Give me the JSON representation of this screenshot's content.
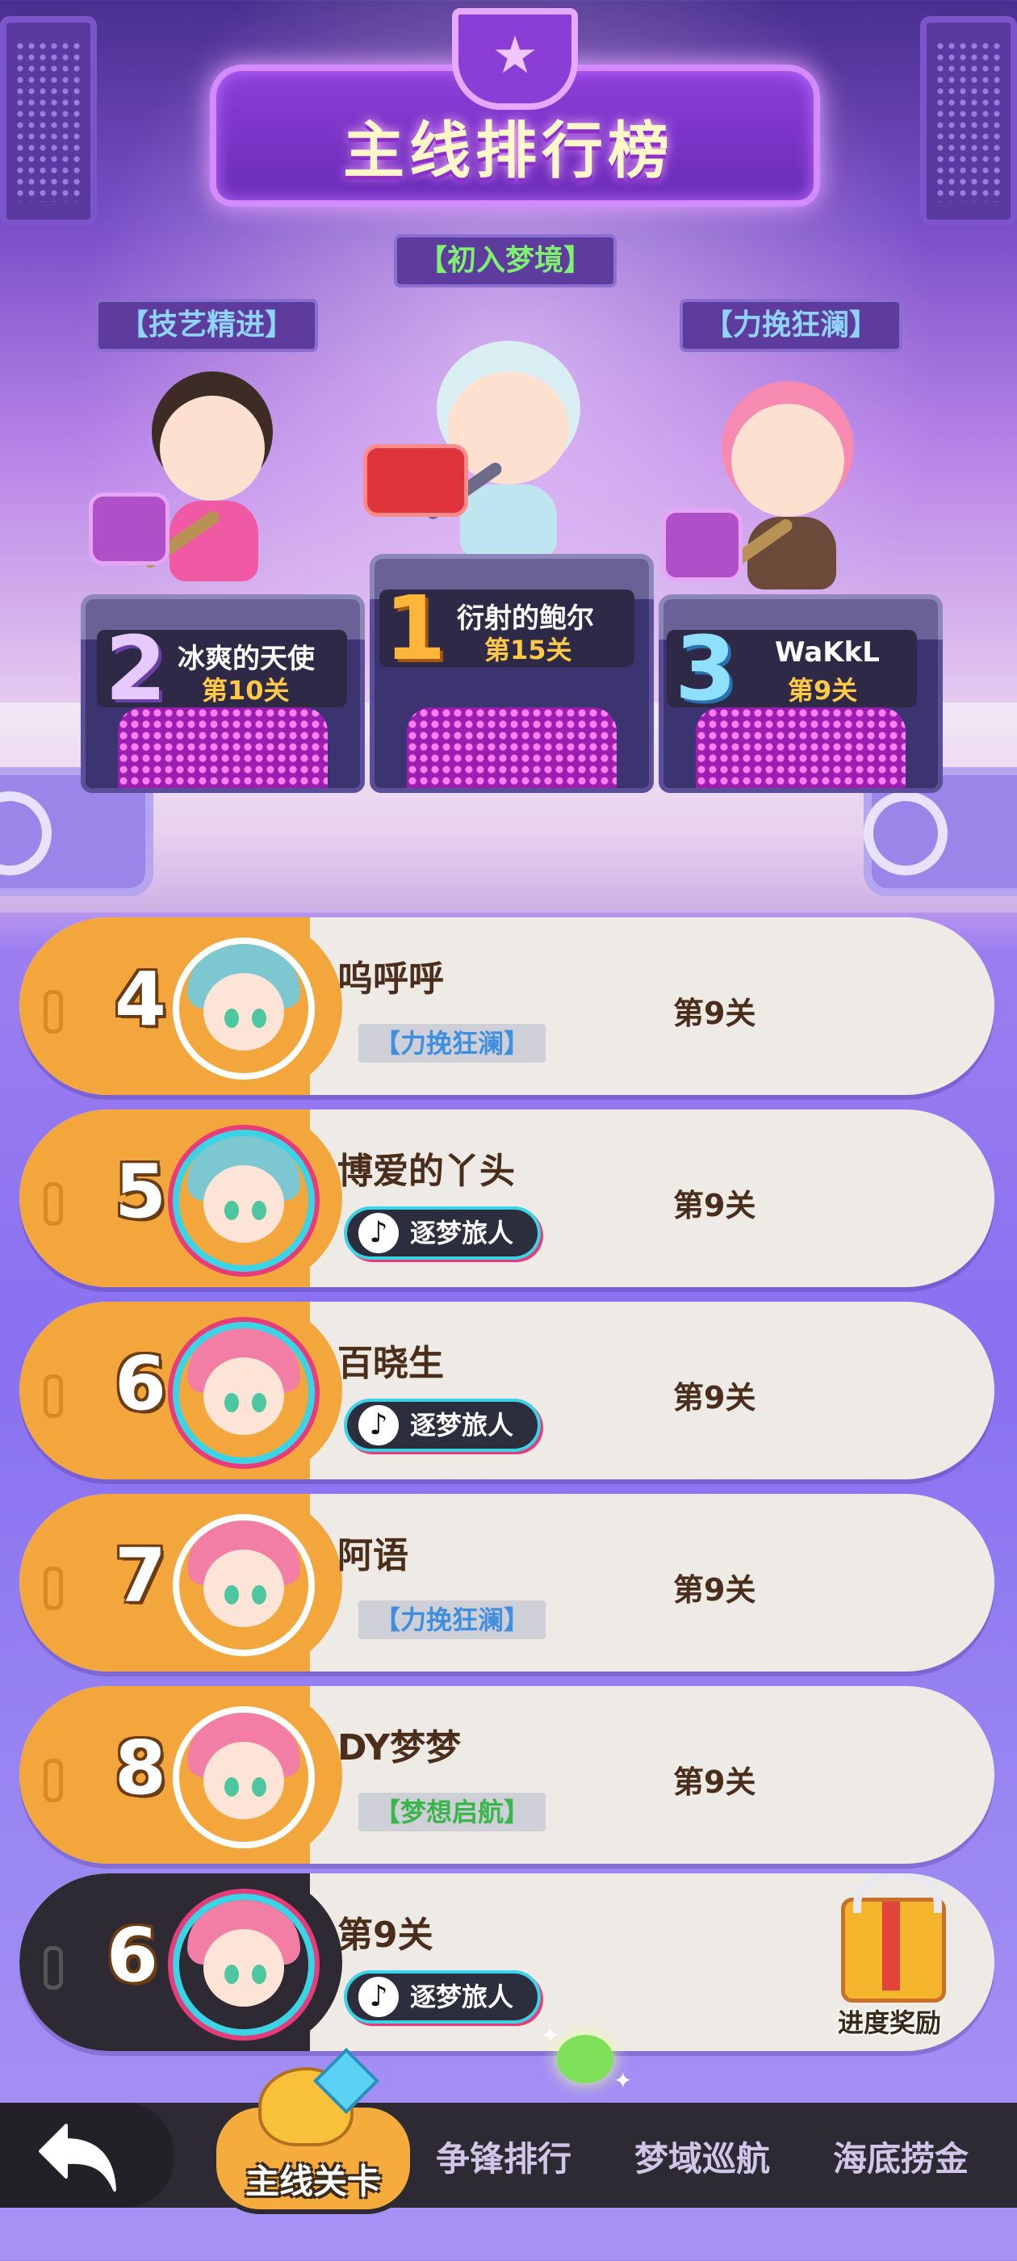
{
  "header": {
    "title": "主线排行榜"
  },
  "podium": {
    "first": {
      "rank": "1",
      "tag": "【初入梦境】",
      "name": "衍射的鲍尔",
      "level": "第15关"
    },
    "second": {
      "rank": "2",
      "tag": "【技艺精进】",
      "name": "冰爽的天使",
      "level": "第10关"
    },
    "third": {
      "rank": "3",
      "tag": "【力挽狂澜】",
      "name": "WaKkL",
      "level": "第9关"
    }
  },
  "rows": [
    {
      "rank": "4",
      "name": "呜呼呼",
      "level": "第9关",
      "title": "【力挽狂澜】"
    },
    {
      "rank": "5",
      "name": "博爱的丫头",
      "level": "第9关",
      "badge": "逐梦旅人"
    },
    {
      "rank": "6",
      "name": "百晓生",
      "level": "第9关",
      "badge": "逐梦旅人"
    },
    {
      "rank": "7",
      "name": "阿语",
      "level": "第9关",
      "title": "【力挽狂澜】"
    },
    {
      "rank": "8",
      "name": "DY梦梦",
      "level": "第9关",
      "title": "【梦想启航】"
    }
  ],
  "self_row": {
    "rank": "6",
    "level": "第9关",
    "badge": "逐梦旅人",
    "reward_label": "进度奖励"
  },
  "bottom_nav": {
    "active": "主线关卡",
    "items": [
      "争锋排行",
      "梦域巡航",
      "海底捞金"
    ]
  },
  "icons": {
    "back": "back-arrow-icon",
    "tiktok": "tiktok-icon",
    "gift": "gift-box-icon",
    "trophy": "trophy-icon"
  },
  "colors": {
    "accent_orange": "#f2a63c",
    "gold_text": "#ffc845",
    "tag_green": "#7ff06f",
    "tag_blue": "#8fd4ff",
    "nav_dark": "#2d2a33"
  }
}
